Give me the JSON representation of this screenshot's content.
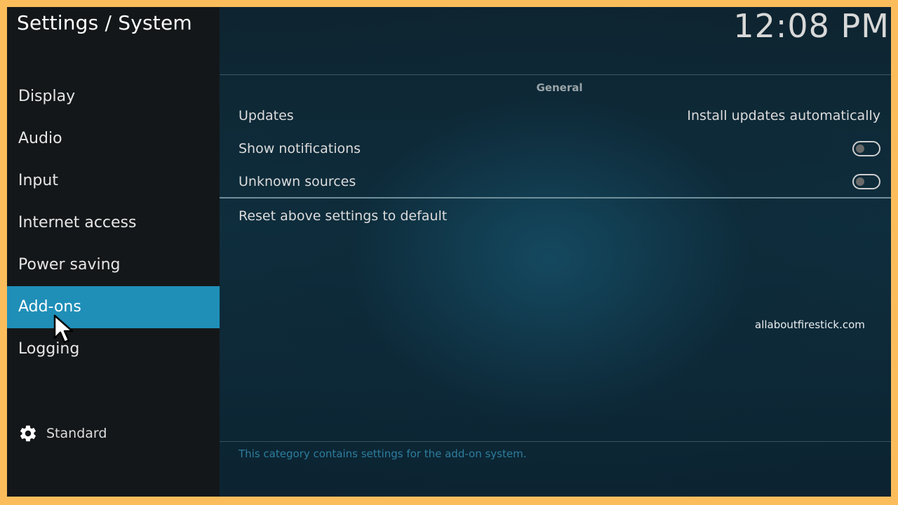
{
  "window": {
    "title": "Settings / System",
    "clock": "12:08 PM"
  },
  "sidebar": {
    "items": [
      {
        "label": "Display"
      },
      {
        "label": "Audio"
      },
      {
        "label": "Input"
      },
      {
        "label": "Internet access"
      },
      {
        "label": "Power saving"
      },
      {
        "label": "Add-ons",
        "active": true
      },
      {
        "label": "Logging"
      }
    ],
    "settings_level": {
      "icon": "gear-icon",
      "label": "Standard"
    }
  },
  "main": {
    "section_header": "General",
    "settings": [
      {
        "label": "Updates",
        "value": "Install updates automatically"
      },
      {
        "label": "Show notifications",
        "toggle": "off"
      },
      {
        "label": "Unknown sources",
        "toggle": "off"
      }
    ],
    "reset_label": "Reset above settings to default",
    "description": "This category contains settings for the add-on system."
  },
  "watermark": "allaboutfirestick.com",
  "colors": {
    "accent": "#1f8fb8",
    "sidebar_bg": "#141719",
    "frame_border": "#fbbd5c",
    "description_text": "#2d7d9d"
  }
}
